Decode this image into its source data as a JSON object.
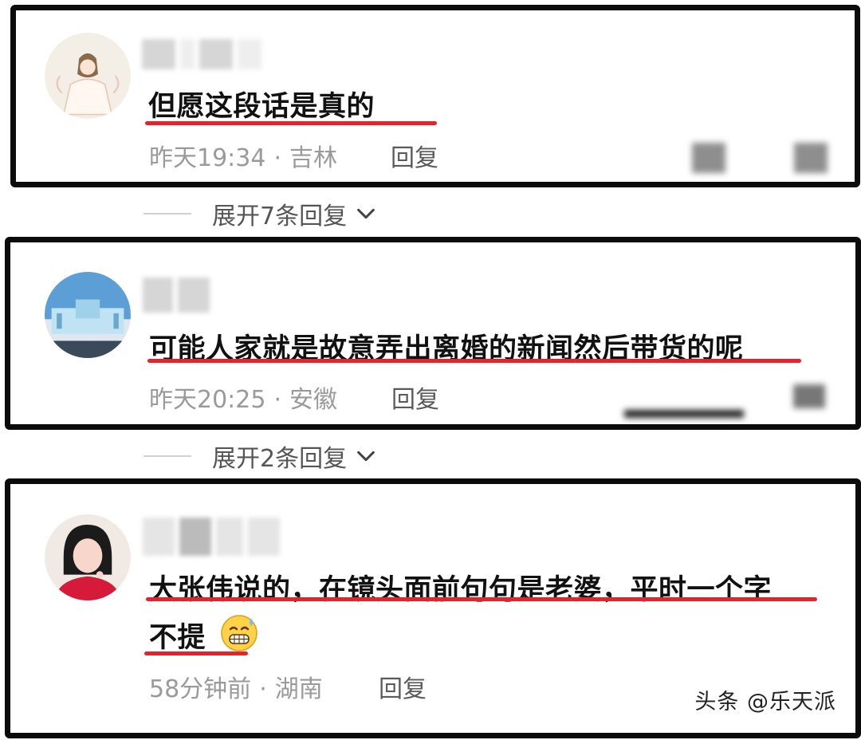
{
  "comments": [
    {
      "text": "但愿这段话是真的",
      "time": "昨天19:34",
      "separator": "·",
      "location": "吉林",
      "reply_label": "回复",
      "avatar_icon": "anime-girl-avatar"
    },
    {
      "text": "可能人家就是故意弄出离婚的新闻然后带货的呢",
      "time": "昨天20:25",
      "separator": "·",
      "location": "安徽",
      "reply_label": "回复",
      "avatar_icon": "building-photo-avatar"
    },
    {
      "text_line1": "大张伟说的，在镜头面前句句是老婆，平时一个字",
      "text_line2": "不提",
      "emoji": "grimacing-sweat-emoji",
      "time": "58分钟前",
      "separator": "·",
      "location": "湖南",
      "reply_label": "回复",
      "avatar_icon": "woman-photo-avatar"
    }
  ],
  "expand_replies": [
    {
      "label": "展开7条回复",
      "icon": "chevron-down-icon"
    },
    {
      "label": "展开2条回复",
      "icon": "chevron-down-icon"
    }
  ],
  "watermark": "头条 @乐天派",
  "colors": {
    "underline": "#e2242d",
    "border": "#0b0b0b",
    "meta": "#9a9a9a"
  }
}
